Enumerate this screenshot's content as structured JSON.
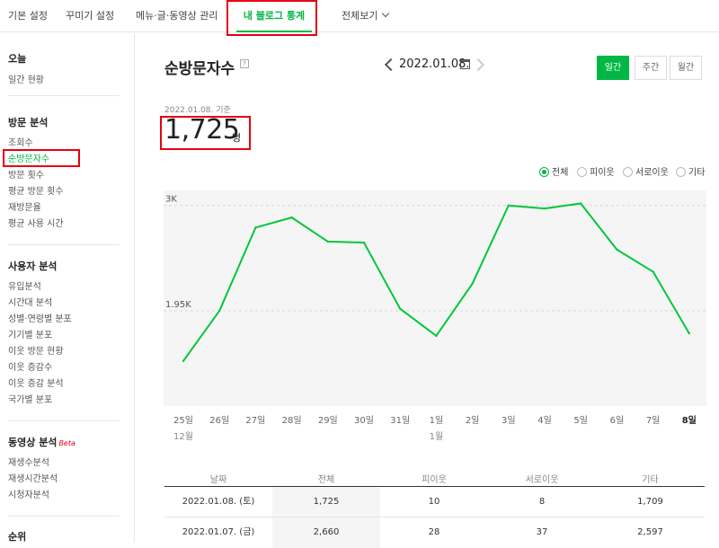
{
  "nav": {
    "tabs": [
      "기본 설정",
      "꾸미기 설정",
      "메뉴·글·동영상 관리",
      "내 블로그 통계",
      "전체보기"
    ]
  },
  "sidebar": {
    "today_head": "오늘",
    "today_items": [
      "일간 현황"
    ],
    "visit_head": "방문 분석",
    "visit_items": [
      "조회수",
      "순방문자수",
      "방문 횟수",
      "평균 방문 횟수",
      "재방문율",
      "평균 사용 시간"
    ],
    "user_head": "사용자 분석",
    "user_items": [
      "유입분석",
      "시간대 분석",
      "성별·연령별 분포",
      "기기별 분포",
      "이웃 방문 현황",
      "이웃 증감수",
      "이웃 증감 분석",
      "국가별 분포"
    ],
    "video_head": "동영상 분석",
    "video_badge": "Beta",
    "video_items": [
      "재생수분석",
      "재생시간분석",
      "시청자분석"
    ],
    "rank_head": "순위"
  },
  "main": {
    "title": "순방문자수",
    "help_icon": "?",
    "date": "2022.01.08.",
    "periods": [
      "일간",
      "주간",
      "월간"
    ],
    "basis": "2022.01.08. 기준",
    "total": "1,725",
    "unit": "명",
    "legend": [
      "전체",
      "피이웃",
      "서로이웃",
      "기타"
    ]
  },
  "chart_data": {
    "type": "line",
    "x": [
      "25일",
      "26일",
      "27일",
      "28일",
      "29일",
      "30일",
      "31일",
      "1일",
      "2일",
      "3일",
      "4일",
      "5일",
      "6일",
      "7일",
      "8일"
    ],
    "x_month_labels": {
      "0": "12월",
      "7": "1월"
    },
    "series": [
      {
        "values": [
          1450,
          1950,
          2780,
          2880,
          2640,
          2630,
          1970,
          1700,
          2220,
          3000,
          2970,
          3020,
          2560,
          2340,
          1725
        ]
      }
    ],
    "yticks": [
      {
        "value": 3000,
        "label": "3K"
      },
      {
        "value": 1950,
        "label": "1.95K"
      }
    ],
    "ylim": [
      1000,
      3150
    ],
    "color": "#00c73c"
  },
  "table": {
    "headers": [
      "날짜",
      "전체",
      "피이웃",
      "서로이웃",
      "기타"
    ],
    "rows": [
      [
        "2022.01.08. (토)",
        "1,725",
        "10",
        "8",
        "1,709"
      ],
      [
        "2022.01.07. (금)",
        "2,660",
        "28",
        "37",
        "2,597"
      ]
    ]
  }
}
